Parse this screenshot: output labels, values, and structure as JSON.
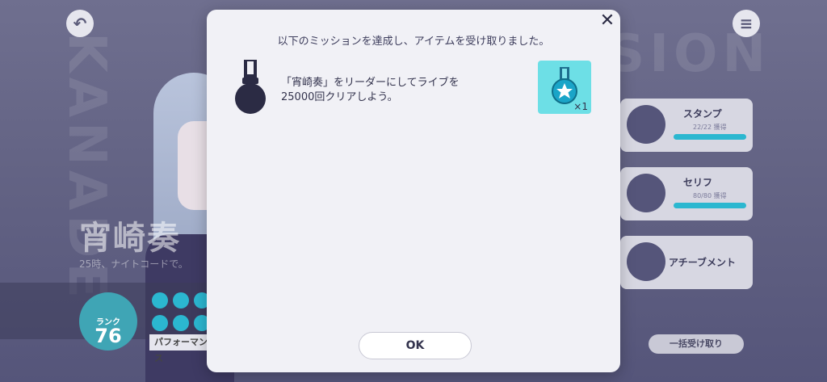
{
  "background": {
    "header_watermark_left": "KANADE",
    "header_watermark_right": "SION",
    "character_name": "宵崎奏",
    "unit_line": "25時、ナイトコードで。",
    "rank": {
      "label": "ランク",
      "value": "76"
    },
    "performance_tag": "パフォーマンス",
    "side_cards": [
      {
        "title": "スタンプ",
        "sub": "22/22 獲得"
      },
      {
        "title": "セリフ",
        "sub": "80/80 獲得"
      },
      {
        "title": "アチーブメント",
        "sub": ""
      }
    ],
    "receive_all_label": "一括受け取り"
  },
  "modal": {
    "heading": "以下のミッションを達成し、アイテムを受け取りました。",
    "mission_text": "「宵崎奏」をリーダーにしてライブを25000回クリアしよう。",
    "reward_count": "×1",
    "ok_label": "OK",
    "close_label": "✕"
  },
  "colors": {
    "accent_cyan": "#2bb7d0",
    "reward_bg": "#6ddfe6",
    "modal_bg": "#f1f1f6"
  },
  "icons": {
    "mission": "medal-icon",
    "reward": "star-medal-icon",
    "back": "back-arrow-icon",
    "menu": "menu-icon"
  }
}
